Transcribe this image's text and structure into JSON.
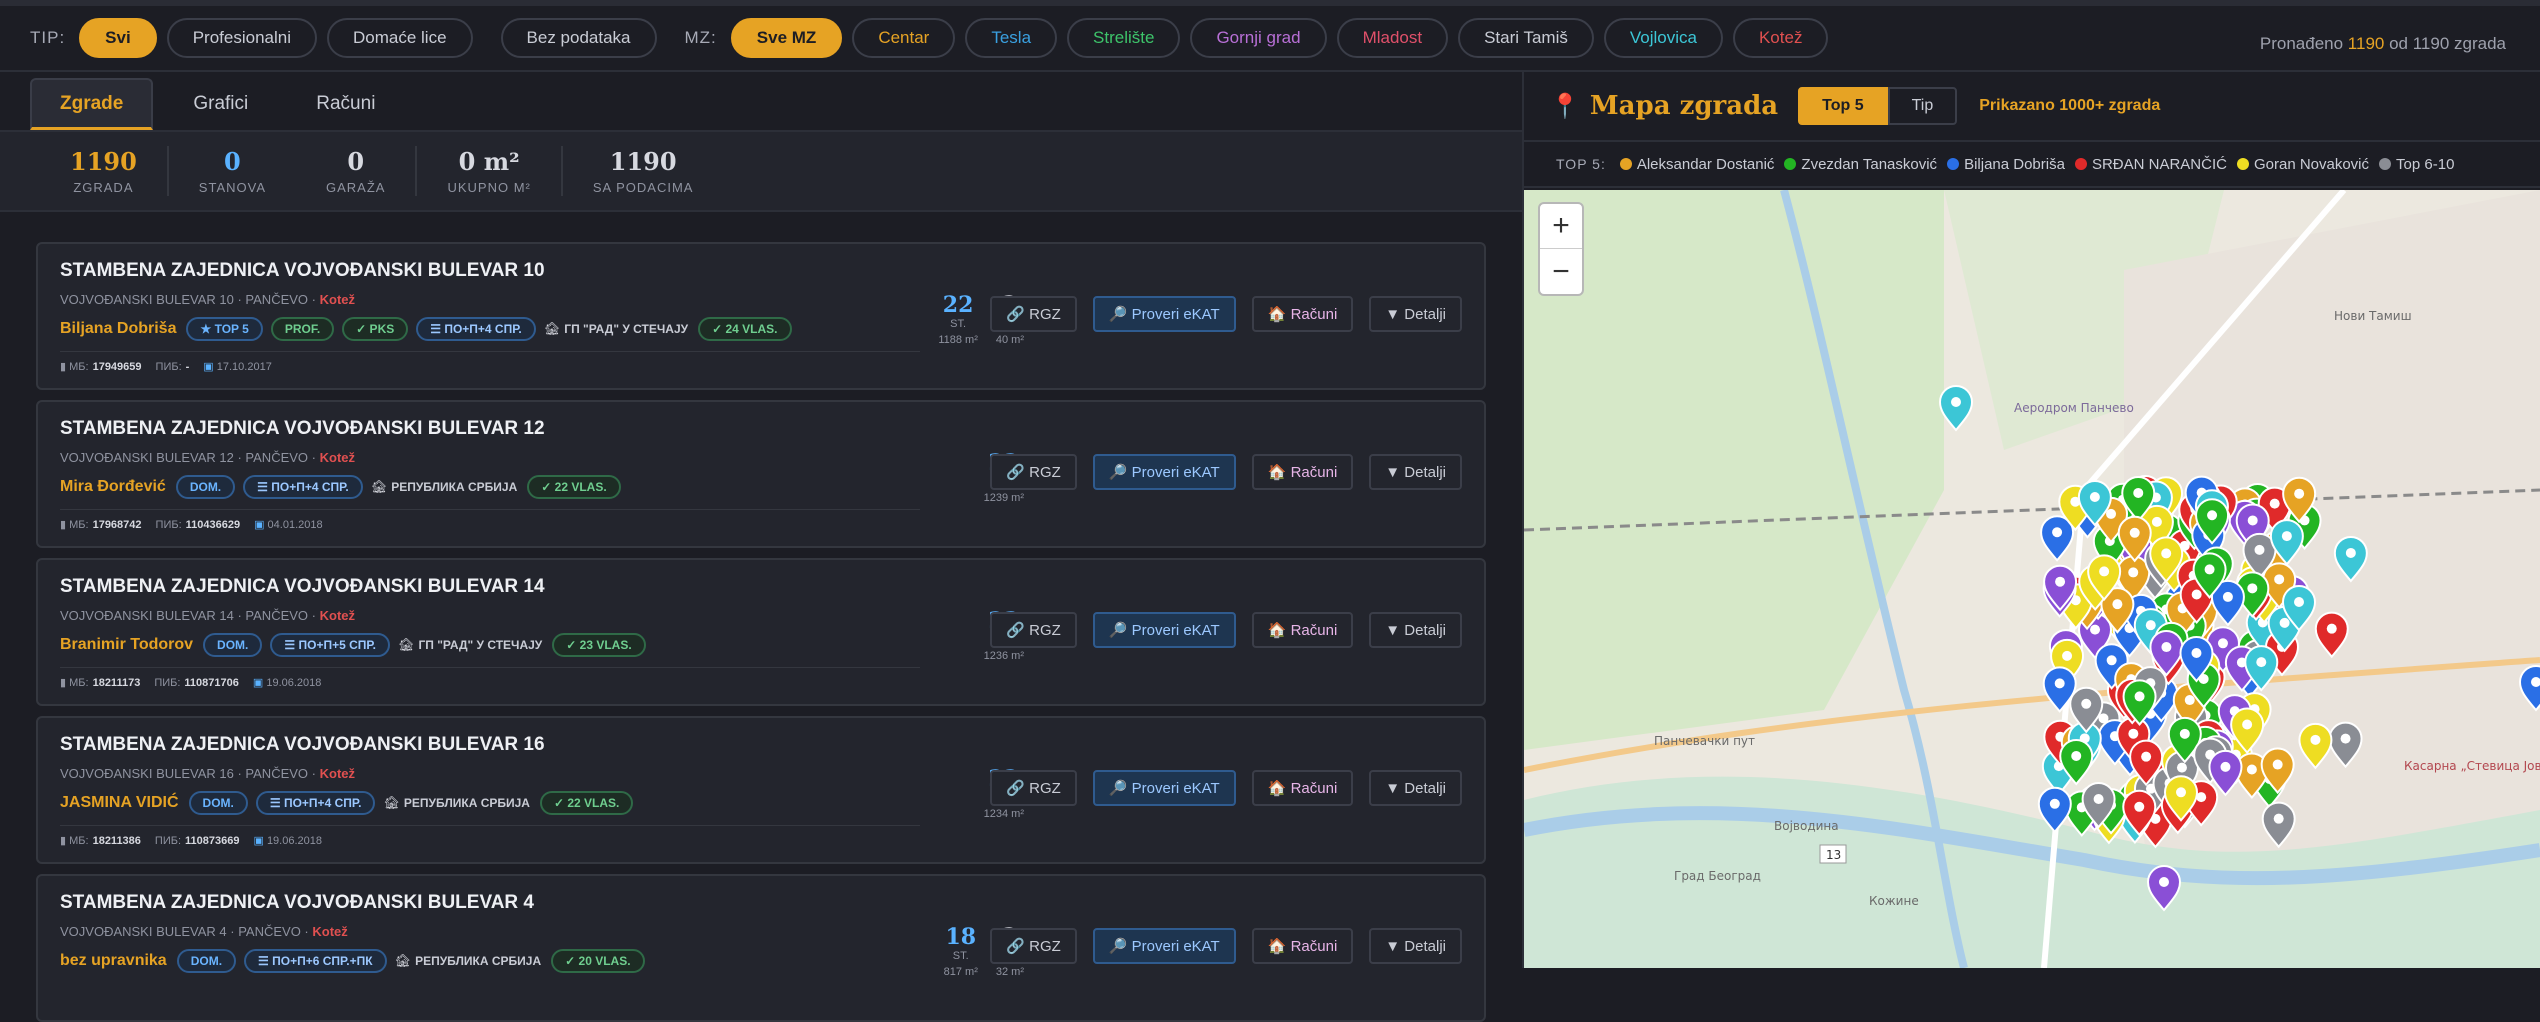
{
  "filters": {
    "tip_label": "TIP:",
    "tip": [
      "Svi",
      "Profesionalni",
      "Domaće lice",
      "Bez podataka"
    ],
    "mz_label": "MZ:",
    "mz": [
      {
        "label": "Sve MZ",
        "color": "#e6a324"
      },
      {
        "label": "Centar",
        "color": "#e6a324"
      },
      {
        "label": "Tesla",
        "color": "#3aa0e0"
      },
      {
        "label": "Strelište",
        "color": "#3dc36a"
      },
      {
        "label": "Gornji grad",
        "color": "#b86fd6"
      },
      {
        "label": "Mladost",
        "color": "#e0506a"
      },
      {
        "label": "Stari Tamiš",
        "color": "#c9ccd5"
      },
      {
        "label": "Vojlovica",
        "color": "#3cc6d6"
      },
      {
        "label": "Kotež",
        "color": "#e05050"
      }
    ],
    "found_prefix": "Pronađeno",
    "found_count": "1190",
    "found_suffix": "od 1190 zgrada"
  },
  "tabs": [
    "Zgrade",
    "Grafici",
    "Računi"
  ],
  "stats": [
    {
      "value": "1190",
      "label": "ZGRADA"
    },
    {
      "value": "0",
      "label": "STANOVA"
    },
    {
      "value": "0",
      "label": "GARAŽA"
    },
    {
      "value": "0 m²",
      "label": "UKUPNO M²"
    },
    {
      "value": "1190",
      "label": "SA PODACIMA"
    }
  ],
  "cards": [
    {
      "title": "STAMBENA ZAJEDNICA VOJVOĐANSKI BULEVAR 10",
      "addr": "VOJVOĐANSKI BULEVAR 10 · PANČEVO ·",
      "zone": "Kotež",
      "owner": "Biljana Dobriša",
      "tags": [
        "★ TOP 5",
        "PROF.",
        "✓ PKS",
        "☰ ПО+П+4 СПР."
      ],
      "firm": "ГП \"РАД\" У СТЕЧАЈУ",
      "vlas": "✓ 24 VLAS.",
      "mb": "17949659",
      "pib": "-",
      "date": "17.10.2017",
      "st": "22",
      "st_label": "ST.",
      "m2": "1188 m²",
      "gar": "2",
      "gar_label": "GAR.",
      "gm2": "40 m²"
    },
    {
      "title": "STAMBENA ZAJEDNICA VOJVOĐANSKI BULEVAR 12",
      "addr": "VOJVOĐANSKI BULEVAR 12 · PANČEVO ·",
      "zone": "Kotež",
      "owner": "Mira Đorđević",
      "tags": [
        "DOM.",
        "☰ ПО+П+4 СПР."
      ],
      "firm": "РЕПУБЛИКА СРБИЈА",
      "vlas": "✓ 22 VLAS.",
      "mb": "17968742",
      "pib": "110436629",
      "date": "04.01.2018",
      "st": "22",
      "st_label": "ST.",
      "m2": "1239 m²"
    },
    {
      "title": "STAMBENA ZAJEDNICA VOJVOĐANSKI BULEVAR 14",
      "addr": "VOJVOĐANSKI BULEVAR 14 · PANČEVO ·",
      "zone": "Kotež",
      "owner": "Branimir Todorov",
      "tags": [
        "DOM.",
        "☰ ПО+П+5 СПР."
      ],
      "firm": "ГП \"РАД\" У СТЕЧАЈУ",
      "vlas": "✓ 23 VLAS.",
      "mb": "18211173",
      "pib": "110871706",
      "date": "19.06.2018",
      "st": "23",
      "st_label": "ST.",
      "m2": "1236 m²"
    },
    {
      "title": "STAMBENA ZAJEDNICA VOJVOĐANSKI BULEVAR 16",
      "addr": "VOJVOĐANSKI BULEVAR 16 · PANČEVO ·",
      "zone": "Kotež",
      "owner": "JASMINA VIDIĆ",
      "tags": [
        "DOM.",
        "☰ ПО+П+4 СПР."
      ],
      "firm": "РЕПУБЛИКА СРБИЈА",
      "vlas": "✓ 22 VLAS.",
      "mb": "18211386",
      "pib": "110873669",
      "date": "19.06.2018",
      "st": "22",
      "st_label": "ST.",
      "m2": "1234 m²"
    },
    {
      "title": "STAMBENA ZAJEDNICA VOJVOĐANSKI BULEVAR 4",
      "addr": "VOJVOĐANSKI BULEVAR 4 · PANČEVO ·",
      "zone": "Kotež",
      "owner": "bez upravnika",
      "tags": [
        "DOM.",
        "☰ ПО+П+6 СПР.+ПК"
      ],
      "firm": "РЕПУБЛИКА СРБИЈА",
      "vlas": "✓ 20 VLAS.",
      "mb": "",
      "pib": "",
      "date": "",
      "st": "18",
      "st_label": "ST.",
      "m2": "817 m²",
      "gar": "2",
      "gar_label": "GAR.",
      "gm2": "32 m²"
    }
  ],
  "card_labels": {
    "mb": "MБ:",
    "pib": "ПИБ:"
  },
  "buttons": {
    "rgz": "RGZ",
    "ekat": "Proveri eKAT",
    "racuni": "Računi",
    "detalji": "▼ Detalji"
  },
  "map": {
    "title": "Mapa zgrada",
    "tabs": [
      "Top 5",
      "Tip"
    ],
    "shown": "Prikazano 1000+ zgrada",
    "legend_label": "TOP 5:",
    "legend": [
      {
        "name": "Aleksandar Dostanić",
        "color": "#e6a324"
      },
      {
        "name": "Zvezdan Tanasković",
        "color": "#23b523"
      },
      {
        "name": "Biljana Dobriša",
        "color": "#2a6fe6"
      },
      {
        "name": "SRĐAN NARANČIĆ",
        "color": "#e02a2a"
      },
      {
        "name": "Goran Novaković",
        "color": "#eedd22"
      },
      {
        "name": "Top 6-10",
        "color": "#8a8d94"
      }
    ],
    "zoom_in": "+",
    "zoom_out": "−",
    "map_labels": [
      "Аеродром Панчево",
      "Касарна „Стевица Јовановић“",
      "Војводина",
      "Град Београд",
      "13",
      "Панчевачки пут",
      "Кожине",
      "Нови Тамиш"
    ]
  }
}
